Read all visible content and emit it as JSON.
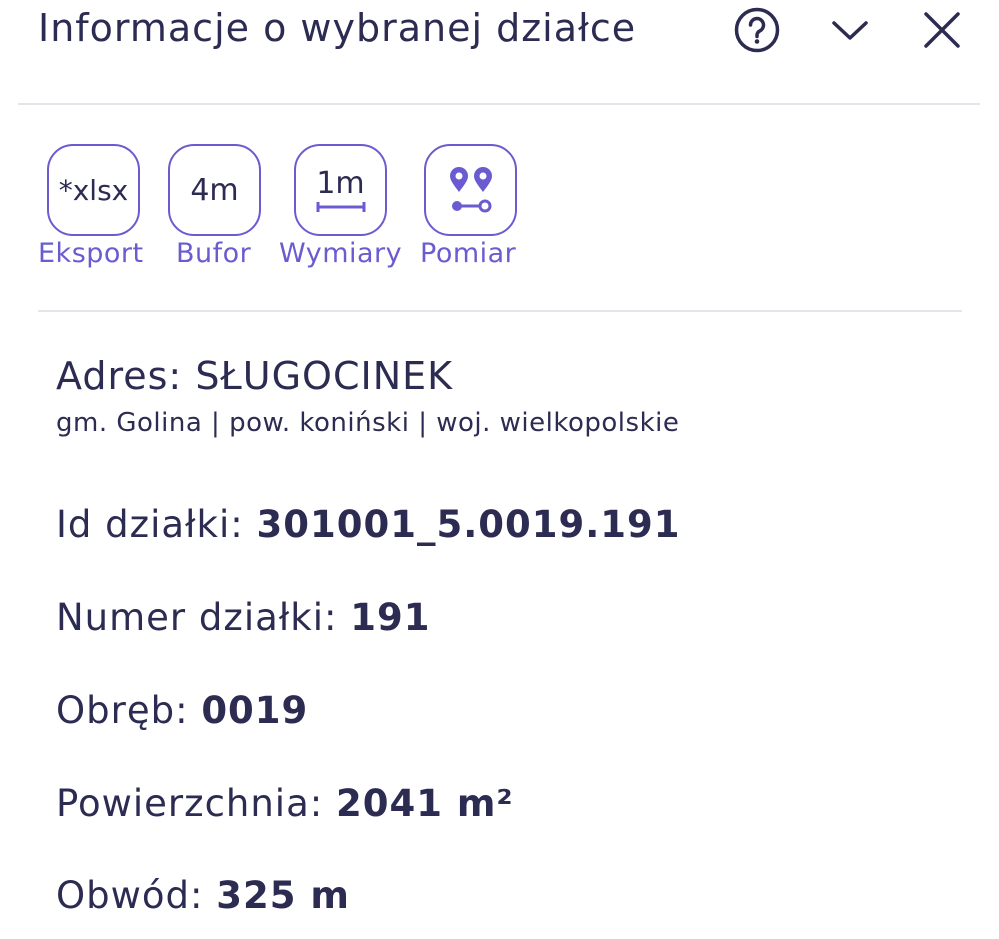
{
  "header": {
    "title": "Informacje o wybranej działce",
    "help_icon": "question-circle-icon",
    "collapse_icon": "chevron-down-icon",
    "close_icon": "close-icon"
  },
  "tools": [
    {
      "icon_text": "*xlsx",
      "label": "Eksport"
    },
    {
      "icon_text": "4m",
      "label": "Bufor"
    },
    {
      "icon_text": "1m",
      "label": "Wymiary"
    },
    {
      "icon": "measure-pins-icon",
      "label": "Pomiar"
    }
  ],
  "parcel": {
    "address_label": "Adres:",
    "address_value": "SŁUGOCINEK",
    "admin_line": "gm. Golina | pow. koniński | woj. wielkopolskie",
    "id_label": "Id działki:",
    "id_value": "301001_5.0019.191",
    "number_label": "Numer działki:",
    "number_value": "191",
    "precinct_label": "Obręb:",
    "precinct_value": "0019",
    "area_label": "Powierzchnia:",
    "area_value": "2041 m²",
    "perimeter_label": "Obwód:",
    "perimeter_value": "325 m"
  },
  "colors": {
    "accent": "#6a5cd0",
    "text": "#2c2b52",
    "divider": "#e4e4ea"
  }
}
